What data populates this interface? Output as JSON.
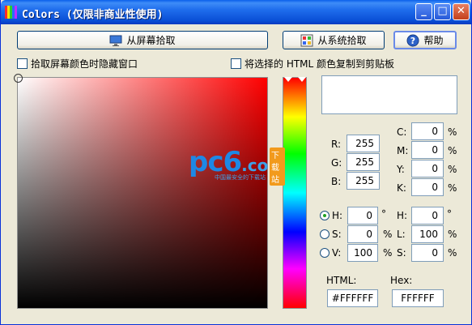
{
  "window": {
    "title": "Colors (仅限非商业性使用)",
    "minimize_glyph": "_",
    "maximize_glyph": "□",
    "close_glyph": "✕"
  },
  "toolbar": {
    "pick_screen_label": "从屏幕拾取",
    "pick_system_label": "从系统拾取",
    "help_label": "帮助"
  },
  "options": {
    "hide_window_label": "拾取屏幕颜色时隐藏窗口",
    "copy_html_label": "将选择的 HTML 颜色复制到剪贴板"
  },
  "rgb": {
    "r_label": "R:",
    "r": "255",
    "g_label": "G:",
    "g": "255",
    "b_label": "B:",
    "b": "255"
  },
  "cmyk": {
    "c_label": "C:",
    "c": "0",
    "m_label": "M:",
    "m": "0",
    "y_label": "Y:",
    "y": "0",
    "k_label": "K:",
    "k": "0",
    "unit": "%"
  },
  "hsv": {
    "h_label": "H:",
    "h": "0",
    "h_unit": "°",
    "s_label": "S:",
    "s": "0",
    "s_unit": "%",
    "v_label": "V:",
    "v": "100",
    "v_unit": "%",
    "selected_channel": "H"
  },
  "hsl": {
    "h_label": "H:",
    "h": "0",
    "h_unit": "°",
    "l_label": "L:",
    "l": "100",
    "l_unit": "%",
    "s_label": "S:",
    "s": "0",
    "s_unit": "%"
  },
  "output": {
    "html_label": "HTML:",
    "html_value": "#FFFFFF",
    "hex_label": "Hex:",
    "hex_value": "FFFFFF"
  },
  "current_color": "#FFFFFF",
  "hue_color": "#FF0000",
  "watermark": {
    "logo": "pc6",
    "suffix": ".com",
    "badge": "下载站",
    "tagline": "中国最安全的下载站"
  }
}
